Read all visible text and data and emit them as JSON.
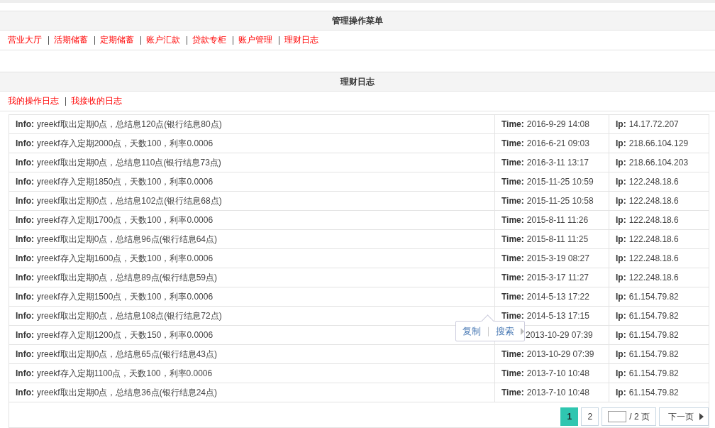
{
  "menu_panel": {
    "title": "管理操作菜单",
    "links": [
      "营业大厅",
      "活期储蓄",
      "定期储蓄",
      "账户汇款",
      "贷款专柜",
      "账户管理",
      "理财日志"
    ]
  },
  "log_panel": {
    "title": "理财日志",
    "links": [
      "我的操作日志",
      "我接收的日志"
    ]
  },
  "log_table": {
    "rows": [
      {
        "info_label": "Info:",
        "info": "yreekf取出定期0点，总结息120点(银行结息80点)",
        "time_label": "Time:",
        "time": "2016-9-29 14:08",
        "ip_label": "Ip:",
        "ip": "14.17.72.207"
      },
      {
        "info_label": "Info:",
        "info": "yreekf存入定期2000点，天数100，利率0.0006",
        "time_label": "Time:",
        "time": "2016-6-21 09:03",
        "ip_label": "Ip:",
        "ip": "218.66.104.129"
      },
      {
        "info_label": "Info:",
        "info": "yreekf取出定期0点，总结息110点(银行结息73点)",
        "time_label": "Time:",
        "time": "2016-3-11 13:17",
        "ip_label": "Ip:",
        "ip": "218.66.104.203"
      },
      {
        "info_label": "Info:",
        "info": "yreekf存入定期1850点，天数100，利率0.0006",
        "time_label": "Time:",
        "time": "2015-11-25 10:59",
        "ip_label": "Ip:",
        "ip": "122.248.18.6"
      },
      {
        "info_label": "Info:",
        "info": "yreekf取出定期0点，总结息102点(银行结息68点)",
        "time_label": "Time:",
        "time": "2015-11-25 10:58",
        "ip_label": "Ip:",
        "ip": "122.248.18.6"
      },
      {
        "info_label": "Info:",
        "info": "yreekf存入定期1700点，天数100，利率0.0006",
        "time_label": "Time:",
        "time": "2015-8-11 11:26",
        "ip_label": "Ip:",
        "ip": "122.248.18.6"
      },
      {
        "info_label": "Info:",
        "info": "yreekf取出定期0点，总结息96点(银行结息64点)",
        "time_label": "Time:",
        "time": "2015-8-11 11:25",
        "ip_label": "Ip:",
        "ip": "122.248.18.6"
      },
      {
        "info_label": "Info:",
        "info": "yreekf存入定期1600点，天数100，利率0.0006",
        "time_label": "Time:",
        "time": "2015-3-19 08:27",
        "ip_label": "Ip:",
        "ip": "122.248.18.6"
      },
      {
        "info_label": "Info:",
        "info": "yreekf取出定期0点，总结息89点(银行结息59点)",
        "time_label": "Time:",
        "time": "2015-3-17 11:27",
        "ip_label": "Ip:",
        "ip": "122.248.18.6"
      },
      {
        "info_label": "Info:",
        "info": "yreekf存入定期1500点，天数100，利率0.0006",
        "time_label": "Time:",
        "time": "2014-5-13 17:22",
        "ip_label": "Ip:",
        "ip": "61.154.79.82"
      },
      {
        "info_label": "Info:",
        "info": "yreekf取出定期0点，总结息108点(银行结息72点)",
        "time_label": "Time:",
        "time": "2014-5-13 17:15",
        "ip_label": "Ip:",
        "ip": "61.154.79.82"
      },
      {
        "info_label": "Info:",
        "info": "yreekf存入定期1200点，天数150，利率0.0006",
        "time": "2013-10-29 07:39",
        "ip_label": "Ip:",
        "ip": "61.154.79.82"
      },
      {
        "info_label": "Info:",
        "info": "yreekf取出定期0点，总结息65点(银行结息43点)",
        "time_label": "Time:",
        "time": "2013-10-29 07:39",
        "ip_label": "Ip:",
        "ip": "61.154.79.82"
      },
      {
        "info_label": "Info:",
        "info": "yreekf存入定期1100点，天数100，利率0.0006",
        "time_label": "Time:",
        "time": "2013-7-10 10:48",
        "ip_label": "Ip:",
        "ip": "61.154.79.82"
      },
      {
        "info_label": "Info:",
        "info": "yreekf取出定期0点，总结息36点(银行结息24点)",
        "time_label": "Time:",
        "time": "2013-7-10 10:48",
        "ip_label": "Ip:",
        "ip": "61.154.79.82"
      }
    ]
  },
  "pagination": {
    "pages": [
      {
        "label": "1",
        "selected": true
      },
      {
        "label": "2",
        "selected": false
      }
    ],
    "total": "/ 2 页",
    "next": "下一页"
  },
  "selection_popup": {
    "actions": [
      "复制",
      "搜索"
    ]
  }
}
